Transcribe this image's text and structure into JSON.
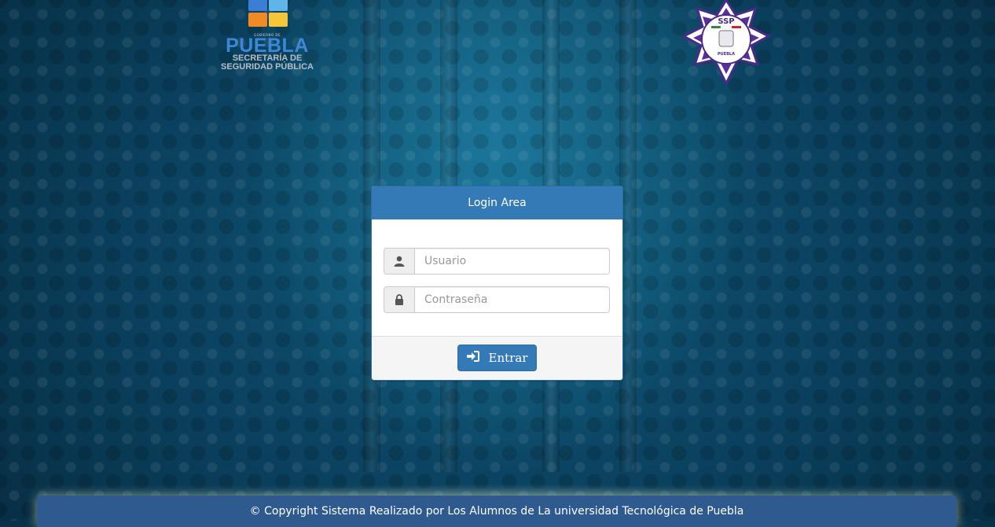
{
  "logos": {
    "left": {
      "small_text": "GOBIERNO DE",
      "title": "PUEBLA",
      "subtitle_line1": "SECRETARÍA DE",
      "subtitle_line2": "SEGURIDAD PÚBLICA"
    },
    "right": {
      "top_text": "SSP",
      "bottom_text": "PUEBLA"
    }
  },
  "login": {
    "title": "Login Area",
    "username_placeholder": "Usuario",
    "password_placeholder": "Contraseña",
    "submit_label": "Entrar",
    "user_icon": "user-icon",
    "lock_icon": "lock-icon",
    "submit_icon": "sign-in-icon"
  },
  "footer": {
    "text": "© Copyright Sistema Realizado por Los Alumnos de La universidad Tecnológica de Puebla"
  },
  "colors": {
    "primary": "#337ab7",
    "footer_bg": "#2f5a8f",
    "background": "#0a3f5c"
  }
}
